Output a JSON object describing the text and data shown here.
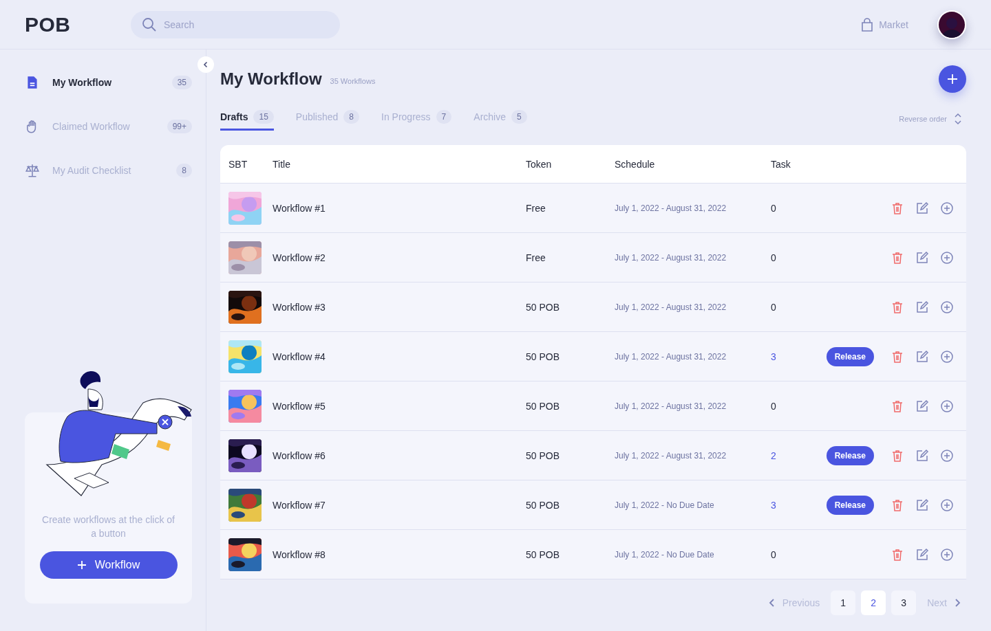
{
  "header": {
    "logo": "POB",
    "search": {
      "placeholder": "Search"
    },
    "market": "Market"
  },
  "sidebar": {
    "items": [
      {
        "label": "My Workflow",
        "count": "35",
        "selected": true,
        "kind": "document"
      },
      {
        "label": "Claimed Workflow",
        "count": "99+",
        "selected": false,
        "kind": "hand"
      },
      {
        "label": "My Audit Checklist",
        "count": "8",
        "selected": false,
        "kind": "scale"
      }
    ],
    "promo": {
      "text": "Create workflows at the click of a button",
      "button": "Workflow"
    }
  },
  "page": {
    "title": "My Workflow",
    "subtitle": "35 Workflows",
    "sort": "Reverse order"
  },
  "tabs": [
    {
      "label": "Drafts",
      "count": "15",
      "selected": true
    },
    {
      "label": "Published",
      "count": "8",
      "selected": false
    },
    {
      "label": "In Progress",
      "count": "7",
      "selected": false
    },
    {
      "label": "Archive",
      "count": "5",
      "selected": false
    }
  ],
  "table": {
    "columns": [
      "SBT",
      "Title",
      "Token",
      "Schedule",
      "Task"
    ],
    "rows": [
      {
        "title": "Workflow #1",
        "token": "Free",
        "schedule": "July 1, 2022 - August 31, 2022",
        "task": "0"
      },
      {
        "title": "Workflow #2",
        "token": "Free",
        "schedule": "July 1, 2022 - August 31, 2022",
        "task": "0"
      },
      {
        "title": "Workflow #3",
        "token": "50 POB",
        "schedule": "July 1, 2022 - August 31, 2022",
        "task": "0"
      },
      {
        "title": "Workflow #4",
        "token": "50 POB",
        "schedule": "July 1, 2022 - August 31, 2022",
        "task": "3",
        "action": "Release"
      },
      {
        "title": "Workflow #5",
        "token": "50 POB",
        "schedule": "July 1, 2022 - August 31, 2022",
        "task": "0"
      },
      {
        "title": "Workflow #6",
        "token": "50 POB",
        "schedule": "July 1, 2022 - August 31, 2022",
        "task": "2",
        "action": "Release"
      },
      {
        "title": "Workflow #7",
        "token": "50 POB",
        "schedule": "July 1, 2022 - No Due Date",
        "task": "3",
        "action": "Release"
      },
      {
        "title": "Workflow #8",
        "token": "50 POB",
        "schedule": "July 1, 2022 - No Due Date",
        "task": "0"
      }
    ]
  },
  "pagination": {
    "previous": "Previous",
    "next": "Next",
    "pages": [
      {
        "label": "1",
        "selected": false
      },
      {
        "label": "2",
        "selected": true
      },
      {
        "label": "3",
        "selected": false
      }
    ]
  }
}
